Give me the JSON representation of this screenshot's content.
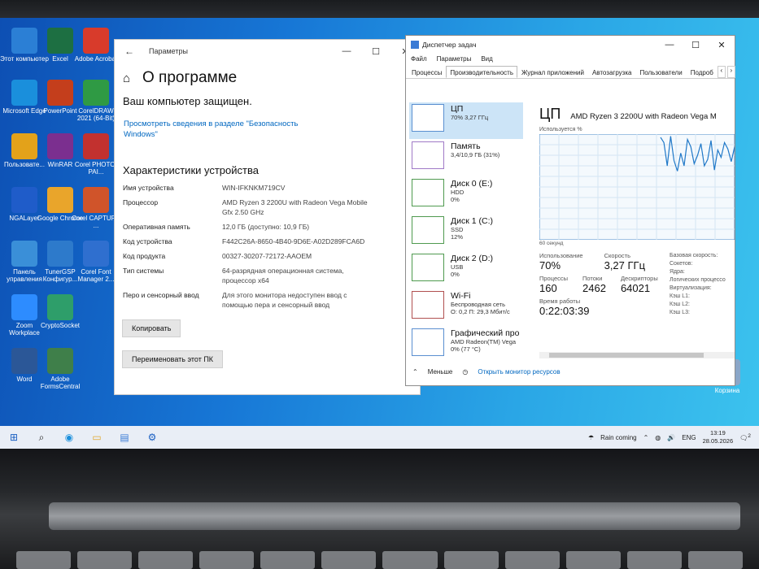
{
  "desktop": {
    "icons": [
      {
        "label": "Этот компьютер",
        "color": "#2b7fd5"
      },
      {
        "label": "Excel",
        "color": "#1d6f42"
      },
      {
        "label": "Adobe Acrobat",
        "color": "#d83b2b"
      },
      {
        "label": "Microsoft Edge",
        "color": "#1a8fdc"
      },
      {
        "label": "PowerPoint",
        "color": "#c43e1c"
      },
      {
        "label": "CorelDRAW 2021 (64-Bit)",
        "color": "#2f9a44"
      },
      {
        "label": "Пользовате...",
        "color": "#e3a21a"
      },
      {
        "label": "WinRAR",
        "color": "#7b2f8f"
      },
      {
        "label": "Corel PHOTO-PAI...",
        "color": "#c2312f"
      },
      {
        "label": "NGALayer",
        "color": "#1f5cc9"
      },
      {
        "label": "Google Chrome",
        "color": "#e9a52b"
      },
      {
        "label": "Corel CAPTURE ...",
        "color": "#d0542a"
      },
      {
        "label": "Панель управления",
        "color": "#3a8fd8"
      },
      {
        "label": "TunerGSP Конфигур...",
        "color": "#2d7acb"
      },
      {
        "label": "Corel Font Manager 2...",
        "color": "#2f6fcf"
      },
      {
        "label": "Zoom Workplace",
        "color": "#2d8cff"
      },
      {
        "label": "CryptoSocket",
        "color": "#2e9e6a"
      },
      {
        "label": "Word",
        "color": "#2b5797"
      },
      {
        "label": "Adobe FormsCentral",
        "color": "#3f7f4a"
      },
      {
        "label": "Корзина",
        "color": "#8aa6c8"
      }
    ]
  },
  "settings": {
    "window_title": "Параметры",
    "heading": "О программе",
    "protected": "Ваш компьютер защищен.",
    "security_link": "Просмотреть сведения в разделе \"Безопасность Windows\"",
    "specs_title": "Характеристики устройства",
    "specs": [
      {
        "k": "Имя устройства",
        "v": "WIN-IFKNKM719CV"
      },
      {
        "k": "Процессор",
        "v": "AMD Ryzen 3 2200U with Radeon Vega Mobile Gfx    2.50 GHz"
      },
      {
        "k": "Оперативная память",
        "v": "12,0 ГБ (доступно: 10,9 ГБ)"
      },
      {
        "k": "Код устройства",
        "v": "F442C26A-8650-4B40-9D6E-A02D289FCA6D"
      },
      {
        "k": "Код продукта",
        "v": "00327-30207-72172-AAOEM"
      },
      {
        "k": "Тип системы",
        "v": "64-разрядная операционная система, процессор x64"
      },
      {
        "k": "Перо и сенсорный ввод",
        "v": "Для этого монитора недоступен ввод с помощью пера и сенсорный ввод"
      }
    ],
    "copy_button": "Копировать",
    "rename_button": "Переименовать этот ПК"
  },
  "taskmgr": {
    "title": "Диспетчер задач",
    "menu": [
      "Файл",
      "Параметры",
      "Вид"
    ],
    "tabs": [
      "Процессы",
      "Производительность",
      "Журнал приложений",
      "Автозагрузка",
      "Пользователи",
      "Подроб"
    ],
    "sidebar": [
      {
        "name": "ЦП",
        "sub": "70% 3,27 ГГц"
      },
      {
        "name": "Память",
        "sub": "3,4/10,9 ГБ (31%)"
      },
      {
        "name": "Диск 0 (E:)",
        "sub": "HDD",
        "sub2": "0%"
      },
      {
        "name": "Диск 1 (C:)",
        "sub": "SSD",
        "sub2": "12%"
      },
      {
        "name": "Диск 2 (D:)",
        "sub": "USB",
        "sub2": "0%"
      },
      {
        "name": "Wi-Fi",
        "sub": "Беспроводная сеть",
        "sub2": "О: 0,2 П: 29,3 Мбит/с"
      },
      {
        "name": "Графический про",
        "sub": "AMD Radeon(TM) Vega",
        "sub2": "0% (77 °C)"
      }
    ],
    "cpu_title": "ЦП",
    "cpu_model": "AMD Ryzen 3 2200U with Radeon Vega M",
    "util_label": "Используется %",
    "graph_foot": "60 секунд",
    "stats": {
      "usage_label": "Использование",
      "usage": "70%",
      "speed_label": "Скорость",
      "speed": "3,27 ГГц",
      "proc_label": "Процессы",
      "proc": "160",
      "threads_label": "Потоки",
      "threads": "2462",
      "handles_label": "Дескрипторы",
      "handles": "64021",
      "uptime_label": "Время работы",
      "uptime": "0:22:03:39"
    },
    "right_labels": [
      "Базовая скорость:",
      "Сокетов:",
      "Ядра:",
      "Логических процессо",
      "Виртуализация:",
      "Кэш L1:",
      "Кэш L2:",
      "Кэш L3:"
    ],
    "less": "Меньше",
    "monitor_link": "Открыть монитор ресурсов"
  },
  "taskbar": {
    "weather": "Rain coming",
    "lang": "ENG",
    "time": "13:19",
    "date": "28.05.2026",
    "notif_count": "2"
  }
}
